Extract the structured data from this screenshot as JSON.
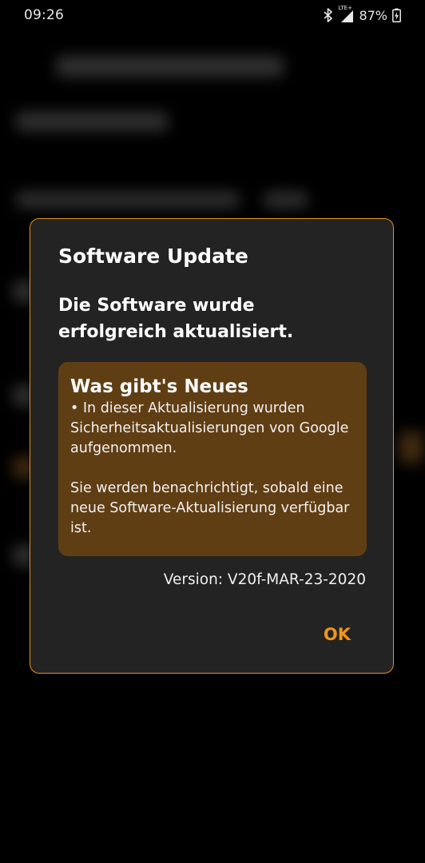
{
  "status_bar": {
    "time": "09:26",
    "network_type": "LTE+",
    "battery_percent": "87%",
    "icons": [
      "bluetooth-icon",
      "signal-icon",
      "battery-charging-icon"
    ]
  },
  "dialog": {
    "title": "Software Update",
    "message": "Die Software wurde erfolgreich aktualisiert.",
    "whats_new": {
      "heading": "Was gibt's Neues",
      "bullet": "• In dieser Aktualisierung wurden Sicherheitsaktualisierungen von Google aufgenommen.",
      "note": "Sie werden benachrichtigt, sobald eine neue Software-Aktualisierung verfügbar ist."
    },
    "version": "Version: V20f-MAR-23-2020",
    "ok_label": "OK"
  },
  "colors": {
    "accent": "#f0951c",
    "dialog_border": "#e8901a",
    "dialog_background": "#232323",
    "info_box_background": "#603e14",
    "screen_background": "#000000"
  }
}
